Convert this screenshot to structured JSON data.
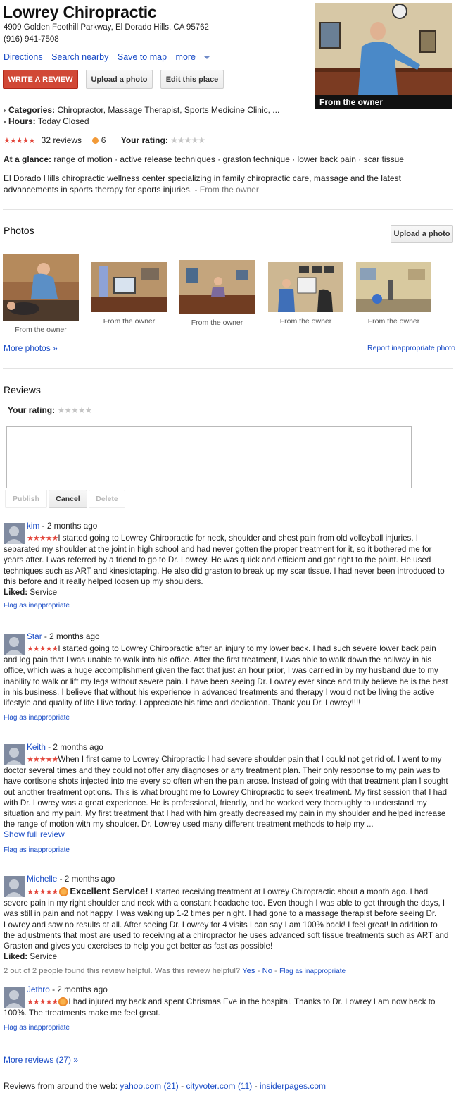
{
  "business": {
    "name": "Lowrey Chiropractic",
    "address": "4909 Golden Foothill Parkway, El Dorado Hills, CA 95762",
    "phone": "(916) 941-7508",
    "actions": {
      "directions": "Directions",
      "search_nearby": "Search nearby",
      "save_to_map": "Save to map",
      "more": "more"
    },
    "buttons": {
      "write_review": "WRITE A REVIEW",
      "upload_photo": "Upload a photo",
      "edit_place": "Edit this place"
    },
    "main_photo_caption": "From the owner",
    "categories_label": "Categories:",
    "categories_value": "Chiropractor, Massage Therapist, Sports Medicine Clinic, ...",
    "hours_label": "Hours:",
    "hours_value": "Today Closed",
    "rating_stars": "★★★★★",
    "reviews_count": "32 reviews",
    "medal_count": "6",
    "your_rating_label": "Your rating:",
    "your_rating_stars": "★★★★★",
    "at_a_glance_label": "At a glance:",
    "at_a_glance_value": "range of motion · active release techniques · graston technique · lower back pain · scar tissue",
    "description": "El Dorado Hills chiropractic wellness center specializing in family chiropractic care, massage and the latest advancements in sports therapy for sports injuries.",
    "description_source": "- From the owner"
  },
  "photos": {
    "heading": "Photos",
    "upload_button": "Upload a photo",
    "captions": [
      "From the owner",
      "From the owner",
      "From the owner",
      "From the owner",
      "From the owner"
    ],
    "more_photos": "More photos »",
    "report": "Report inappropriate photo"
  },
  "reviews_section": {
    "heading": "Reviews",
    "your_rating_label": "Your rating:",
    "your_rating_stars": "★★★★★",
    "publish": "Publish",
    "cancel": "Cancel",
    "delete": "Delete"
  },
  "reviews": [
    {
      "author": "kim",
      "when": "- 2 months ago",
      "stars": "★★★★★",
      "text": "I started going to Lowrey Chiropractic for neck, shoulder and chest pain from old volleyball injuries. I separated my shoulder at the joint in high school and had never gotten the proper treatment for it, so it bothered me for years after. I was referred by a friend to go to Dr. Lowrey. He was quick and efficient and got right to the point. He used techniques such as ART and kinesiotaping. He also did graston to break up my scar tissue. I had never been introduced to this before and it really helped loosen up my shoulders.",
      "liked_label": "Liked:",
      "liked_value": "Service",
      "flag": "Flag as inappropriate"
    },
    {
      "author": "Star",
      "when": "- 2 months ago",
      "stars": "★★★★★",
      "text": "I started going to Lowrey Chiropractic after an injury to my lower back. I had such severe lower back pain and leg pain that I was unable to walk into his office. After the first treatment, I was able to walk down the hallway in his office, which was a huge accomplishment given the fact that just an hour prior, I was carried in by my husband due to my inability to walk or lift my legs without severe pain. I have been seeing Dr. Lowrey ever since and truly believe he is the best in his business. I believe that without his experience in advanced treatments and therapy I would not be living the active lifestyle and quality of life I live today. I appreciate his time and dedication. Thank you Dr. Lowrey!!!!",
      "flag": "Flag as inappropriate"
    },
    {
      "author": "Keith",
      "when": "- 2 months ago",
      "stars": "★★★★★",
      "text": "When I first came to Lowrey Chiropractic I had severe shoulder pain that I could not get rid of. I went to my doctor several times and they could not offer any diagnoses or any treatment plan. Their only response to my pain was to have cortisone shots injected into me every so often when the pain arose. Instead of going with that treatment plan I sought out another treatment options. This is what brought me to Lowrey Chiropractic to seek treatment. My first session that I had with Dr. Lowrey was a great experience. He is professional, friendly, and he worked very thoroughly to understand my situation and my pain. My first treatment that I had with him greatly decreased my pain in my shoulder and helped increase the range of motion with my shoulder. Dr. Lowrey used many different treatment methods to help my ...",
      "show_full": "Show full review",
      "flag": "Flag as inappropriate"
    },
    {
      "author": "Michelle",
      "when": "- 2 months ago",
      "stars": "★★★★★",
      "headline": "Excellent Service!",
      "text": "I started receiving treatment at Lowrey Chiropractic about a month ago. I had severe pain in my right shoulder and neck with a constant headache too. Even though I was able to get through the days, I was still in pain and not happy. I was waking up 1-2 times per night. I had gone to a massage therapist before seeing Dr. Lowrey and saw no results at all. After seeing Dr. Lowrey for 4 visits I can say I am 100% back! I feel great! In addition to the adjustments that most are used to receiving at a chiropractor he uses advanced soft tissue treatments such as ART and Graston and gives you exercises to help you get better as fast as possible!",
      "liked_label": "Liked:",
      "liked_value": "Service",
      "helpful": "2 out of 2 people found this review helpful. Was this review helpful?",
      "yes": "Yes",
      "no": "No",
      "flag": "Flag as inappropriate"
    },
    {
      "author": "Jethro",
      "when": "- 2 months ago",
      "stars": "★★★★★",
      "text": "I had injured my back and spent Chrismas Eve in the hospital. Thanks to Dr. Lowrey I am now back to 100%. The ttreatments make me feel great.",
      "flag": "Flag as inappropriate"
    }
  ],
  "footer": {
    "more_reviews": "More reviews (27) »",
    "web_label": "Reviews from around the web:",
    "sources": [
      "yahoo.com (21)",
      "cityvoter.com (11)",
      "insiderpages.com"
    ]
  }
}
